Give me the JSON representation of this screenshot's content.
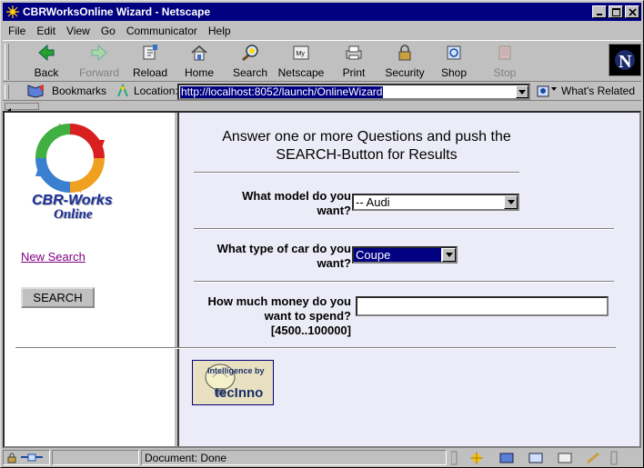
{
  "window": {
    "title": "CBRWorksOnline Wizard - Netscape"
  },
  "menu": [
    {
      "label": "File"
    },
    {
      "label": "Edit"
    },
    {
      "label": "View"
    },
    {
      "label": "Go"
    },
    {
      "label": "Communicator"
    },
    {
      "label": "Help"
    }
  ],
  "toolbar": {
    "back": "Back",
    "forward": "Forward",
    "reload": "Reload",
    "home": "Home",
    "search": "Search",
    "netscape": "Netscape",
    "print": "Print",
    "security": "Security",
    "shop": "Shop",
    "stop": "Stop"
  },
  "location": {
    "bookmarks": "Bookmarks",
    "label": "Location:",
    "url": "http://localhost:8052/launch/OnlineWizard",
    "whats_related": "What's Related"
  },
  "left": {
    "logo_line1": "CBR-Works",
    "logo_line2": "Online",
    "new_search": "New Search",
    "search_button": "SEARCH"
  },
  "right": {
    "heading_line1": "Answer one or more Questions and push the",
    "heading_line2": "SEARCH-Button for Results",
    "q1_line1": "What model do you",
    "q1_line2": "want?",
    "q1_value": "-- Audi",
    "q2_line1": "What type of car do you",
    "q2_line2": "want?",
    "q2_value": "Coupe",
    "q3_line1": "How much money do you",
    "q3_line2": "want to spend?",
    "q3_line3": "[4500..100000]",
    "q3_value": "",
    "badge_line1": "Intelligence by",
    "badge_line2": "tecInno"
  },
  "status": {
    "text": "Document: Done"
  }
}
